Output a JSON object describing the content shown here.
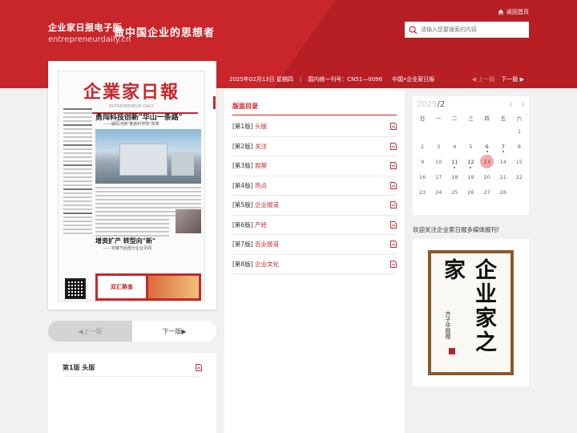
{
  "header": {
    "brand_name": "企业家日报电子版",
    "brand_domain": "entrepreneurdaily.cn",
    "slogan": "做中国企业的思想者",
    "home_link": "返回首页",
    "search_placeholder": "请输入您要搜索的内容"
  },
  "infobar": {
    "date": "2025年02月13日 星期四",
    "issn": "国内统一刊号：CN51—0096",
    "source": "中国•企业家日报",
    "prev_label": "上一版",
    "next_label": "下一版"
  },
  "paper": {
    "masthead": "企業家日報",
    "masthead_sub": "ENTREPRENEUR DAILY",
    "headline1": "勇闯科技创新\"华山一条路\"",
    "subhead1": "——解码河南\"量谱科学院\"改革",
    "headline2": "增资扩产 转型向\"新\"",
    "subhead2": "——安徽节后部分企业见闻",
    "ad_brand": "双汇熟食"
  },
  "pager": {
    "prev": "上一版",
    "next": "下一版"
  },
  "current_page": {
    "label": "第1版 头版"
  },
  "layout_list": {
    "title": "版面目录",
    "items": [
      {
        "num": "[第1版]",
        "name": "头版"
      },
      {
        "num": "[第2版]",
        "name": "关注"
      },
      {
        "num": "[第3版]",
        "name": "观察"
      },
      {
        "num": "[第4版]",
        "name": "热点"
      },
      {
        "num": "[第5版]",
        "name": "企业报道"
      },
      {
        "num": "[第6版]",
        "name": "产经"
      },
      {
        "num": "[第7版]",
        "name": "百业报道"
      },
      {
        "num": "[第8版]",
        "name": "企业文化"
      }
    ]
  },
  "calendar": {
    "year": "2025",
    "month": "/2",
    "weekdays": [
      "日",
      "一",
      "二",
      "三",
      "四",
      "五",
      "六"
    ],
    "weeks": [
      [
        "",
        "",
        "",
        "",
        "",
        "",
        "1"
      ],
      [
        "2",
        "3",
        "4",
        "5",
        "6",
        "7",
        "8"
      ],
      [
        "9",
        "10",
        "11",
        "12",
        "13",
        "14",
        "15"
      ],
      [
        "16",
        "17",
        "18",
        "19",
        "20",
        "21",
        "22"
      ],
      [
        "23",
        "24",
        "25",
        "26",
        "27",
        "28",
        ""
      ]
    ],
    "published_days": [
      "6",
      "7",
      "11",
      "12",
      "13"
    ],
    "selected_day": "13"
  },
  "promo": {
    "text": "欢迎关注企业家日报多媒体报刊!",
    "calligraphy": "企业家之家",
    "signature": "齐子华题赠"
  },
  "colors": {
    "brand_red": "#c8262b",
    "selected_day_bg": "#f2a9ac"
  }
}
